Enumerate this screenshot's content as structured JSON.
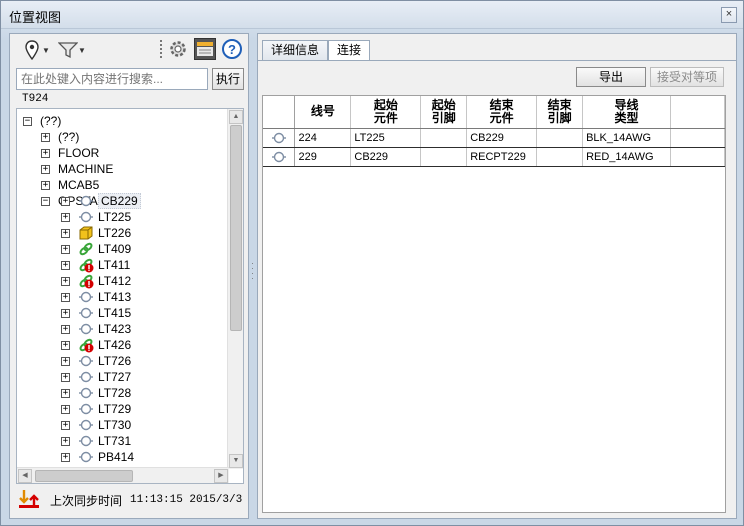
{
  "window": {
    "title": "位置视图",
    "close_glyph": "×"
  },
  "toolbar": {
    "pin_icon": "location-pin-icon",
    "filter_icon": "filter-funnel-icon",
    "settings_icon": "gear-icon",
    "boards_icon": "clapperboard-icon",
    "help_icon": "help-icon",
    "help_glyph": "?"
  },
  "search": {
    "placeholder": "在此处键入内容进行搜索...",
    "value": "",
    "execute_label": "执行"
  },
  "context_label": "T924",
  "tree": {
    "nodes": [
      {
        "label": "(??)",
        "expander": "minus",
        "icon": "none",
        "level": 0
      },
      {
        "label": "(??)",
        "expander": "plus",
        "icon": "none",
        "level": 1
      },
      {
        "label": "FLOOR",
        "expander": "plus",
        "icon": "none",
        "level": 1
      },
      {
        "label": "MACHINE",
        "expander": "plus",
        "icon": "none",
        "level": 1
      },
      {
        "label": "MCAB5",
        "expander": "plus",
        "icon": "none",
        "level": 1
      },
      {
        "label": "OPSTA3",
        "expander": "minus",
        "icon": "none",
        "level": 1
      },
      {
        "label": "CB229",
        "expander": "plus",
        "icon": "connector",
        "level": 2,
        "selected": true
      },
      {
        "label": "LT225",
        "expander": "plus",
        "icon": "connector",
        "level": 2
      },
      {
        "label": "LT226",
        "expander": "plus",
        "icon": "device-box",
        "level": 2
      },
      {
        "label": "LT409",
        "expander": "plus",
        "icon": "splice",
        "level": 2
      },
      {
        "label": "LT411",
        "expander": "plus",
        "icon": "splice-error",
        "level": 2
      },
      {
        "label": "LT412",
        "expander": "plus",
        "icon": "splice-error",
        "level": 2
      },
      {
        "label": "LT413",
        "expander": "plus",
        "icon": "connector",
        "level": 2
      },
      {
        "label": "LT415",
        "expander": "plus",
        "icon": "connector",
        "level": 2
      },
      {
        "label": "LT423",
        "expander": "plus",
        "icon": "connector",
        "level": 2
      },
      {
        "label": "LT426",
        "expander": "plus",
        "icon": "splice-error",
        "level": 2
      },
      {
        "label": "LT726",
        "expander": "plus",
        "icon": "connector",
        "level": 2
      },
      {
        "label": "LT727",
        "expander": "plus",
        "icon": "connector",
        "level": 2
      },
      {
        "label": "LT728",
        "expander": "plus",
        "icon": "connector",
        "level": 2
      },
      {
        "label": "LT729",
        "expander": "plus",
        "icon": "connector",
        "level": 2
      },
      {
        "label": "LT730",
        "expander": "plus",
        "icon": "connector",
        "level": 2
      },
      {
        "label": "LT731",
        "expander": "plus",
        "icon": "connector",
        "level": 2
      },
      {
        "label": "PB414",
        "expander": "plus",
        "icon": "connector",
        "level": 2
      }
    ]
  },
  "status": {
    "sync_icon": "sync-arrows-icon",
    "sync_label": "上次同步时间",
    "sync_time": "11:13:15 2015/3/3"
  },
  "tabs": [
    {
      "label": "详细信息",
      "active": false
    },
    {
      "label": "连接",
      "active": true
    }
  ],
  "actions": {
    "export_label": "导出",
    "accept_label": "接受对等项"
  },
  "grid": {
    "columns": [
      "",
      "线号",
      "起始\n元件",
      "起始\n引脚",
      "结束\n元件",
      "结束\n引脚",
      "导线\n类型",
      ""
    ],
    "rows": [
      {
        "icon": "connector",
        "cells": [
          "224",
          "LT225",
          "",
          "CB229",
          "",
          "BLK_14AWG",
          ""
        ]
      },
      {
        "icon": "connector",
        "cells": [
          "229",
          "CB229",
          "",
          "RECPT229",
          "",
          "RED_14AWG",
          ""
        ]
      }
    ]
  },
  "colors": {
    "error_red": "#d40000",
    "splice_green": "#3aa63a",
    "device_yellow": "#f2c21b",
    "help_blue": "#1f5fb8"
  }
}
